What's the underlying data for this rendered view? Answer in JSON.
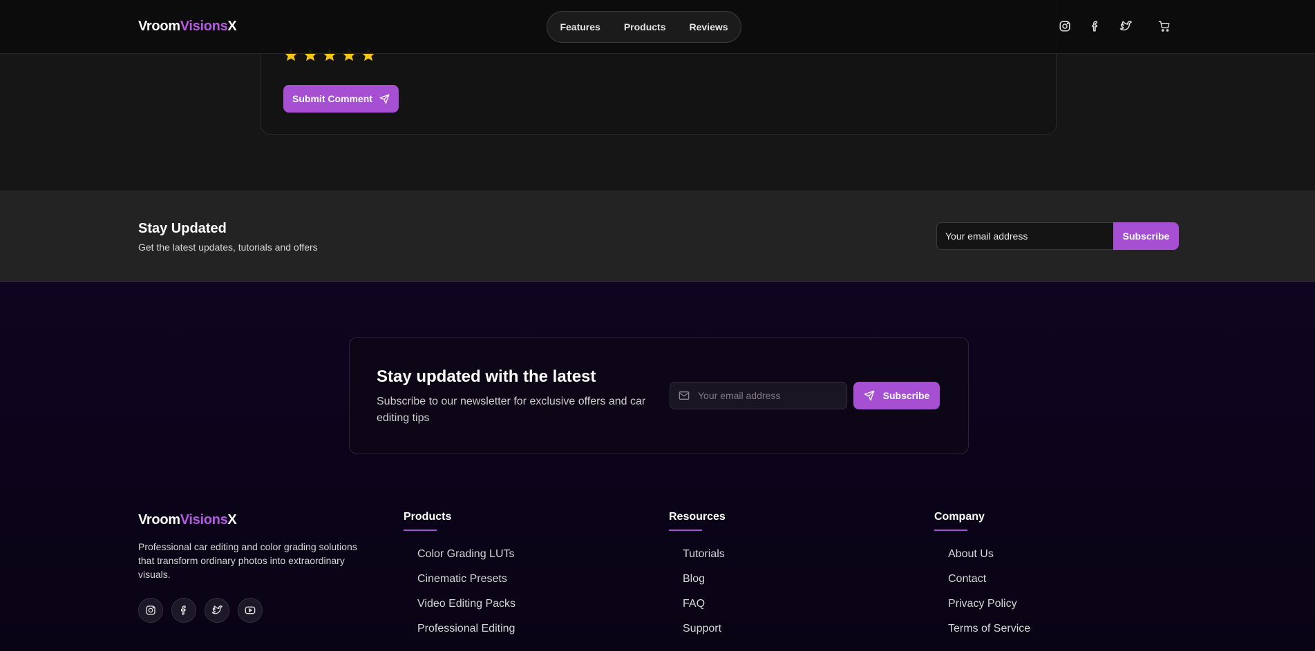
{
  "colors": {
    "accent": "#a64fd3",
    "logo_accent": "#b45ae0",
    "star": "#f5c518"
  },
  "brand": {
    "part1": "Vroom",
    "part2": "Visions",
    "part3": "X"
  },
  "header": {
    "nav": [
      "Features",
      "Products",
      "Reviews"
    ],
    "icons": [
      "instagram-icon",
      "facebook-icon",
      "twitter-icon",
      "cart-icon"
    ]
  },
  "review": {
    "stars": 5,
    "submit_label": "Submit Comment"
  },
  "band": {
    "title": "Stay Updated",
    "subtitle": "Get the latest updates, tutorials and offers",
    "input_placeholder": "Your email address",
    "button_label": "Subscribe"
  },
  "newsletter": {
    "title": "Stay updated with the latest",
    "subtitle": "Subscribe to our newsletter for exclusive offers and car editing tips",
    "input_placeholder": "Your email address",
    "button_label": "Subscribe"
  },
  "footer": {
    "description": "Professional car editing and color grading solutions that transform ordinary photos into extraordinary visuals.",
    "social": [
      "instagram-icon",
      "facebook-icon",
      "twitter-icon",
      "youtube-icon"
    ],
    "columns": [
      {
        "title": "Products",
        "links": [
          "Color Grading LUTs",
          "Cinematic Presets",
          "Video Editing Packs",
          "Professional Editing"
        ]
      },
      {
        "title": "Resources",
        "links": [
          "Tutorials",
          "Blog",
          "FAQ",
          "Support"
        ]
      },
      {
        "title": "Company",
        "links": [
          "About Us",
          "Contact",
          "Privacy Policy",
          "Terms of Service"
        ]
      }
    ]
  }
}
